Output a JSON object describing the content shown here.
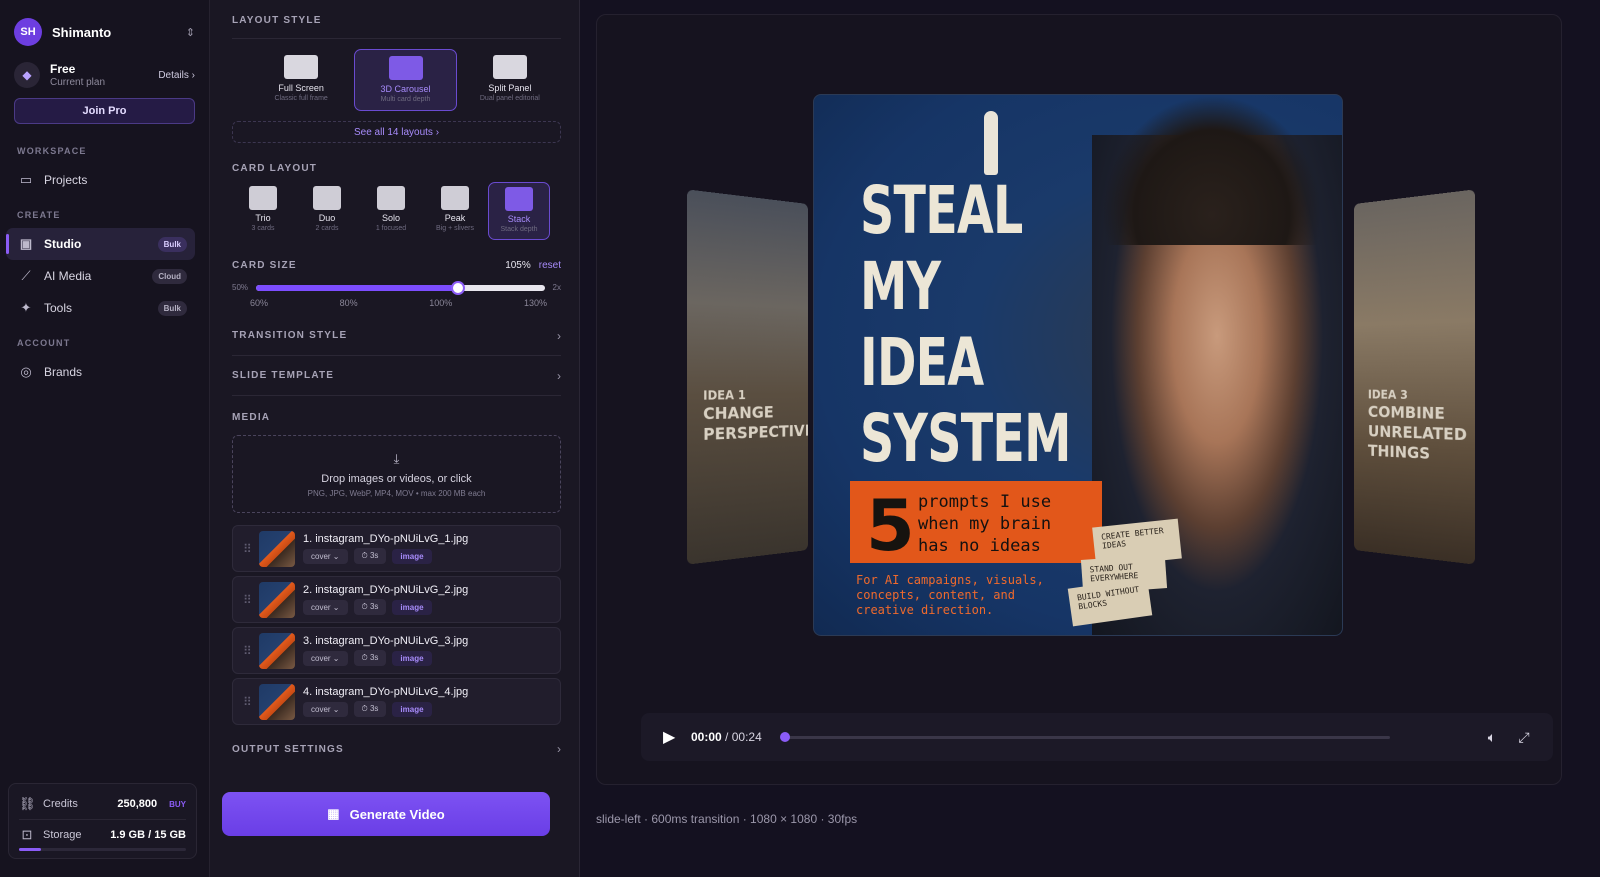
{
  "user": {
    "initials": "SH",
    "name": "Shimanto"
  },
  "plan": {
    "name": "Free",
    "sub": "Current plan",
    "details": "Details ›",
    "cta": "Join Pro"
  },
  "nav": {
    "workspace_label": "WORKSPACE",
    "projects": "Projects",
    "create_label": "CREATE",
    "studio": "Studio",
    "studio_pill": "Bulk",
    "ai_media": "AI Media",
    "ai_media_pill": "Cloud",
    "tools": "Tools",
    "tools_pill": "Bulk",
    "account_label": "ACCOUNT",
    "brands": "Brands"
  },
  "credits": {
    "label": "Credits",
    "value": "250,800",
    "buy": "BUY"
  },
  "storage": {
    "label": "Storage",
    "value": "1.9 GB / 15 GB",
    "fill": 0.13
  },
  "layout_style": {
    "title": "LAYOUT STYLE",
    "options": [
      {
        "name": "Full Screen",
        "sub": "Classic full frame"
      },
      {
        "name": "3D Carousel",
        "sub": "Multi card depth"
      },
      {
        "name": "Split Panel",
        "sub": "Dual panel editorial"
      }
    ],
    "see_all": "See all 14 layouts ›"
  },
  "card_layout": {
    "title": "CARD LAYOUT",
    "options": [
      {
        "name": "Trio",
        "sub": "3 cards"
      },
      {
        "name": "Duo",
        "sub": "2 cards"
      },
      {
        "name": "Solo",
        "sub": "1 focused"
      },
      {
        "name": "Peak",
        "sub": "Big + slivers"
      },
      {
        "name": "Stack",
        "sub": "Stack depth"
      }
    ]
  },
  "card_size": {
    "title": "CARD SIZE",
    "value": "105%",
    "reset": "reset",
    "min": "50%",
    "max": "2x",
    "level": 0.7,
    "ticks": [
      "60%",
      "80%",
      "100%",
      "130%"
    ]
  },
  "sections": {
    "transition": "TRANSITION STYLE",
    "template": "SLIDE TEMPLATE",
    "media": "MEDIA",
    "output": "OUTPUT SETTINGS"
  },
  "dropzone": {
    "main": "Drop images or videos, or click",
    "sub": "PNG, JPG, WebP, MP4, MOV • max 200 MB each"
  },
  "files": [
    {
      "name": "1. instagram_DYo-pNUiLvG_1.jpg",
      "fit": "cover",
      "dur": "3s",
      "type": "image"
    },
    {
      "name": "2. instagram_DYo-pNUiLvG_2.jpg",
      "fit": "cover",
      "dur": "3s",
      "type": "image"
    },
    {
      "name": "3. instagram_DYo-pNUiLvG_3.jpg",
      "fit": "cover",
      "dur": "3s",
      "type": "image"
    },
    {
      "name": "4. instagram_DYo-pNUiLvG_4.jpg",
      "fit": "cover",
      "dur": "3s",
      "type": "image"
    }
  ],
  "generate": "Generate Video",
  "poster": {
    "title_lines": [
      "STEAL",
      "MY",
      "IDEA",
      "SYSTEM"
    ],
    "big_number": "5",
    "prompt_lines": [
      "prompts I use",
      "when my brain",
      "has no ideas"
    ],
    "for_ai_lines": [
      "For AI campaigns, visuals,",
      "concepts, content, and",
      "creative direction."
    ],
    "notes": [
      "CREATE BETTER IDEAS",
      "STAND OUT EVERYWHERE",
      "BUILD WITHOUT BLOCKS"
    ]
  },
  "side_left": {
    "l1": "IDEA 1",
    "l2": "CHANGE",
    "l3": "PERSPECTIVE"
  },
  "side_right": {
    "l1": "IDEA 3",
    "l2": "COMBINE",
    "l3": "UNRELATED",
    "l4": "THINGS"
  },
  "player": {
    "current": "00:00",
    "sep": "/",
    "total": "00:24",
    "progress": 0
  },
  "footer": "slide-left · 600ms transition · 1080 × 1080 · 30fps"
}
